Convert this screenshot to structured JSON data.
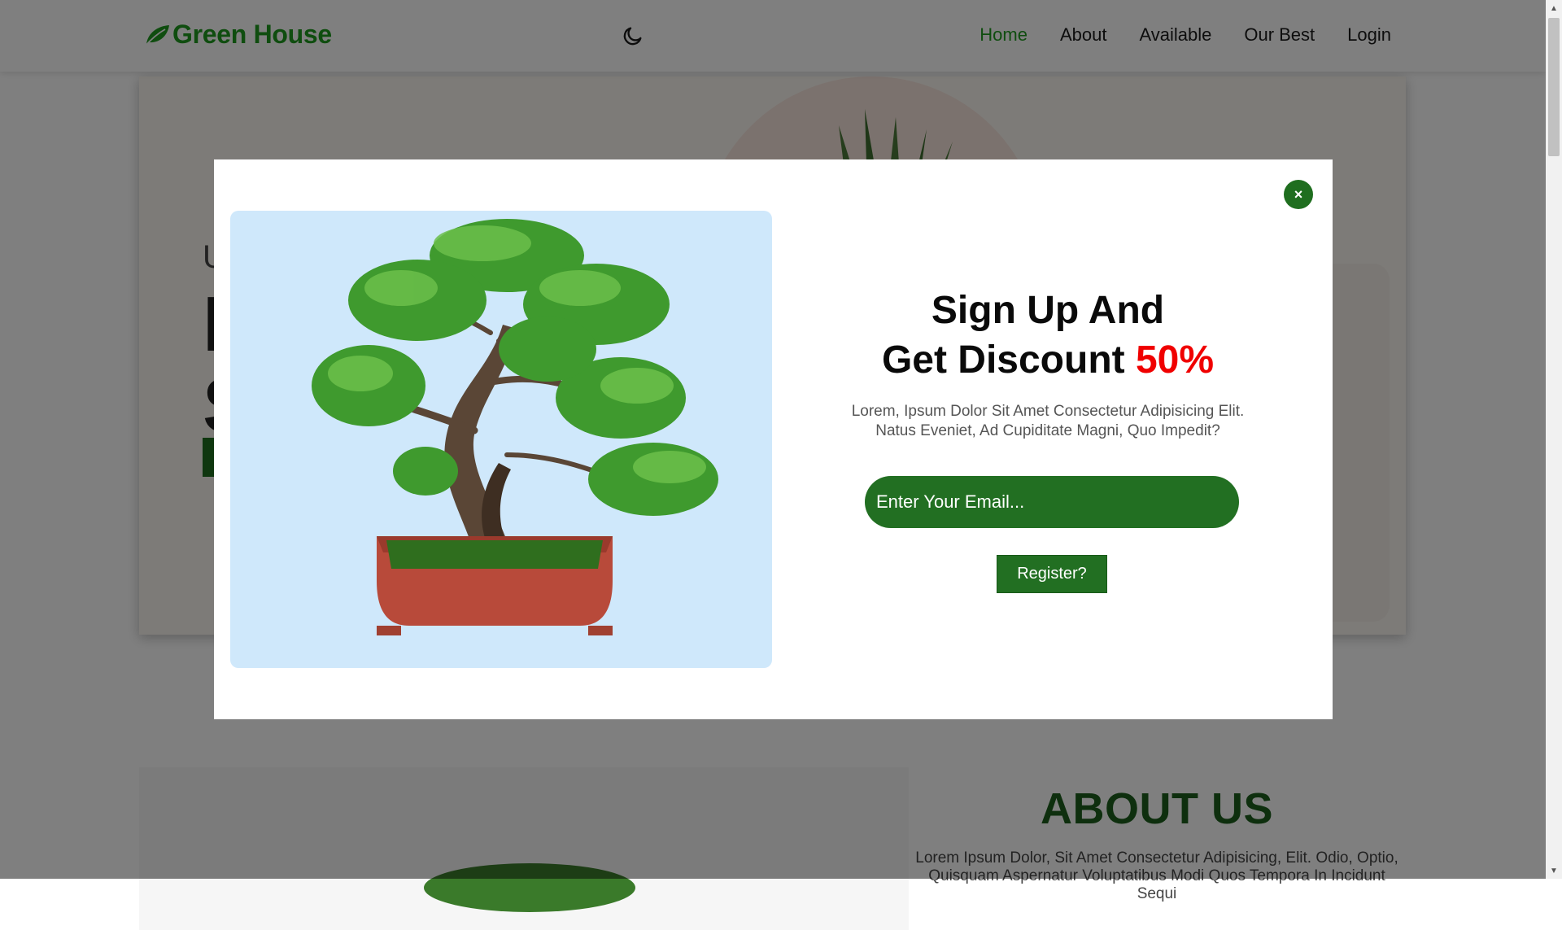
{
  "nav": {
    "logo_text": "Green House",
    "links": [
      {
        "label": "Home",
        "active": true
      },
      {
        "label": "About",
        "active": false
      },
      {
        "label": "Available",
        "active": false
      },
      {
        "label": "Our Best",
        "active": false
      },
      {
        "label": "Login",
        "active": false
      }
    ],
    "theme_icon": "moon-icon"
  },
  "hero": {
    "subtitle": "U",
    "title_line1": "I",
    "title_line2": "S"
  },
  "modal": {
    "title_line1": "Sign Up And",
    "title_line2_prefix": "Get Discount ",
    "title_line2_highlight": "50%",
    "description": "Lorem, Ipsum Dolor Sit Amet Consectetur Adipisicing Elit. Natus Eveniet, Ad Cupiditate Magni, Quo Impedit?",
    "email_placeholder": "Enter Your Email...",
    "register_label": "Register?",
    "close_label": "×",
    "image_icon": "bonsai-tree-image"
  },
  "about": {
    "title": "ABOUT US",
    "text": "Lorem Ipsum Dolor, Sit Amet Consectetur Adipisicing, Elit. Odio, Optio, Quisquam Aspernatur Voluptatibus Modi Quos Tempora In Incidunt Sequi"
  },
  "colors": {
    "brand_green": "#1f9a1f",
    "dark_green": "#226f22",
    "accent_red": "#f00000"
  }
}
